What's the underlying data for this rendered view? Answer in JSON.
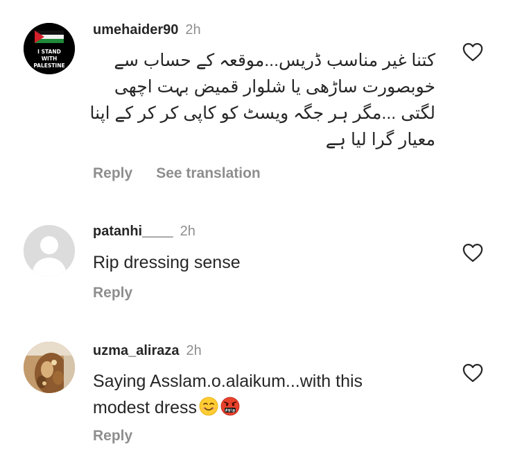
{
  "comments": [
    {
      "username": "umehaider90",
      "time": "2h",
      "text_lines": [
        "کتنا غیر مناسب ڈریس...موقعہ کے حساب سے",
        "خوبصورت ساڑھی یا شلوار قمیض بہت اچھی",
        "لگتی ...مگر ہر جگہ ویسٹ کو کاپی کر کر کے اپنا",
        "معیار گرا لیا ہے"
      ],
      "reply_label": "Reply",
      "translate_label": "See translation",
      "avatar": {
        "type": "badge",
        "lines": [
          "I STAND",
          "WITH",
          "PALESTINE"
        ],
        "flag": "palestine-flag-icon"
      }
    },
    {
      "username": "patanhi____",
      "time": "2h",
      "text": "Rip dressing sense",
      "reply_label": "Reply",
      "avatar": {
        "type": "default-profile"
      }
    },
    {
      "username": "uzma_aliraza",
      "time": "2h",
      "text_line1": "Saying Asslam.o.alaikum...with this",
      "text_line2": "modest dress",
      "emojis": [
        "smiling-face-icon",
        "face-with-symbols-on-mouth-icon"
      ],
      "reply_label": "Reply",
      "avatar": {
        "type": "photo"
      }
    }
  ],
  "icons": {
    "like": "heart-outline-icon"
  },
  "colors": {
    "text": "#262626",
    "secondary": "#8e8e8e",
    "background": "#ffffff"
  }
}
